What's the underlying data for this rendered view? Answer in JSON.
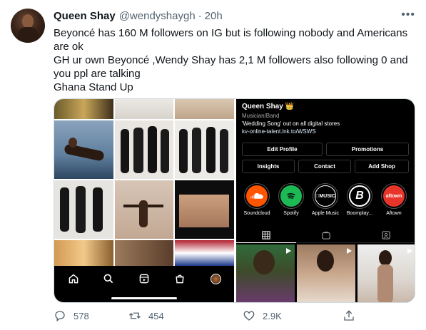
{
  "tweet": {
    "author_name": "Queen Shay",
    "author_handle": "@wendyshaygh",
    "separator": "·",
    "time": "20h",
    "more": "•••",
    "lines": [
      "Beyoncé has 160 M followers on IG but is following nobody and Americans are ok",
      "GH ur own Beyoncé ,Wendy Shay has 2,1 M followers also following 0 and you ppl are talking",
      "Ghana Stand Up"
    ]
  },
  "profile": {
    "name": "Queen Shay 👑",
    "category": "Musician/Band",
    "bio": "'Wedding Song' out on all digital stores",
    "link": "kv-online-talent.lnk.to/WSWS",
    "buttons_row1": [
      "Edit Profile",
      "Promotions"
    ],
    "buttons_row2": [
      "Insights",
      "Contact",
      "Add Shop"
    ],
    "highlights": [
      {
        "label": "Soundcloud",
        "text": "",
        "bg": "#ff5500"
      },
      {
        "label": "Spotify",
        "text": "",
        "bg": "#1db954"
      },
      {
        "label": "Apple Music",
        "text": "MUSIC",
        "bg": "#000000"
      },
      {
        "label": "Boomplay...",
        "text": "B",
        "bg": "#000000"
      },
      {
        "label": "Aftown",
        "text": "aftown",
        "bg": "#e8352b"
      }
    ]
  },
  "actions": {
    "reply_count": "578",
    "retweet_count": "454",
    "like_count": "2.9K"
  },
  "colors": {
    "text_primary": "#0f1419",
    "text_secondary": "#536471",
    "border": "#cfd9de"
  },
  "icons": [
    "more-icon",
    "home-icon",
    "search-icon",
    "reels-icon",
    "shop-icon",
    "profile-avatar-icon",
    "grid-icon",
    "igtv-icon",
    "tagged-icon",
    "reply-icon",
    "retweet-icon",
    "like-icon",
    "share-icon"
  ]
}
